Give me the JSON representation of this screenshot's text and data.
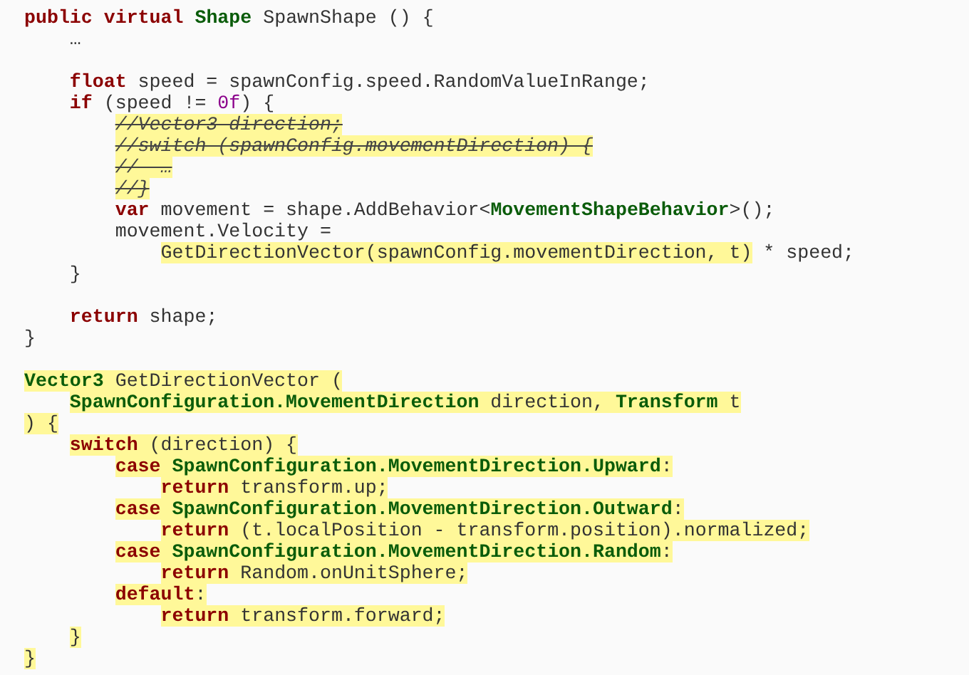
{
  "code_lines": [
    {
      "kind": "code",
      "spans": [
        {
          "text": "public",
          "kind": "keyword",
          "highlighted": false
        },
        {
          "text": " virtual",
          "kind": "keyword",
          "highlighted": false
        },
        {
          "text": " Shape",
          "kind": "type",
          "highlighted": false
        },
        {
          "text": " SpawnShape () {",
          "kind": "plain",
          "highlighted": false
        }
      ]
    },
    {
      "kind": "code",
      "spans": [
        {
          "text": "    …",
          "kind": "plain",
          "highlighted": false
        }
      ]
    },
    {
      "kind": "blank"
    },
    {
      "kind": "code",
      "spans": [
        {
          "text": "    float",
          "kind": "keyword",
          "highlighted": false
        },
        {
          "text": " speed = spawnConfig.speed.RandomValueInRange;",
          "kind": "plain",
          "highlighted": false
        }
      ]
    },
    {
      "kind": "code",
      "spans": [
        {
          "text": "    if",
          "kind": "keyword",
          "highlighted": false
        },
        {
          "text": " (speed != ",
          "kind": "plain",
          "highlighted": false
        },
        {
          "text": "0f",
          "kind": "number",
          "highlighted": false
        },
        {
          "text": ") {",
          "kind": "plain",
          "highlighted": false
        }
      ]
    },
    {
      "kind": "code",
      "spans": [
        {
          "text": "        //Vector3 direction;",
          "kind": "comment",
          "highlighted": true
        }
      ]
    },
    {
      "kind": "code",
      "spans": [
        {
          "text": "        //switch (spawnConfig.movementDirection) {",
          "kind": "comment",
          "highlighted": true
        }
      ]
    },
    {
      "kind": "code",
      "spans": [
        {
          "text": "        //  …",
          "kind": "comment",
          "highlighted": true
        }
      ]
    },
    {
      "kind": "code",
      "spans": [
        {
          "text": "        //}",
          "kind": "comment",
          "highlighted": true
        }
      ]
    },
    {
      "kind": "code",
      "spans": [
        {
          "text": "        var",
          "kind": "keyword",
          "highlighted": false
        },
        {
          "text": " movement = shape.AddBehavior<",
          "kind": "plain",
          "highlighted": false
        },
        {
          "text": "MovementShapeBehavior",
          "kind": "type",
          "highlighted": false
        },
        {
          "text": ">();",
          "kind": "plain",
          "highlighted": false
        }
      ]
    },
    {
      "kind": "code",
      "spans": [
        {
          "text": "        movement.Velocity =",
          "kind": "plain",
          "highlighted": false
        }
      ]
    },
    {
      "kind": "code",
      "spans": [
        {
          "text": "            GetDirectionVector(spawnConfig.movementDirection, t)",
          "kind": "plain",
          "highlighted": true
        },
        {
          "text": " * speed;",
          "kind": "plain",
          "highlighted": false
        }
      ]
    },
    {
      "kind": "code",
      "spans": [
        {
          "text": "    }",
          "kind": "plain",
          "highlighted": false
        }
      ]
    },
    {
      "kind": "blank"
    },
    {
      "kind": "code",
      "spans": [
        {
          "text": "    return",
          "kind": "keyword",
          "highlighted": false
        },
        {
          "text": " shape;",
          "kind": "plain",
          "highlighted": false
        }
      ]
    },
    {
      "kind": "code",
      "spans": [
        {
          "text": "}",
          "kind": "plain",
          "highlighted": false
        }
      ]
    },
    {
      "kind": "blank"
    },
    {
      "kind": "code",
      "spans": [
        {
          "text": "Vector3",
          "kind": "type",
          "highlighted": true
        },
        {
          "text": " GetDirectionVector (",
          "kind": "plain",
          "highlighted": true
        }
      ]
    },
    {
      "kind": "code",
      "spans": [
        {
          "text": "    SpawnConfiguration.MovementDirection",
          "kind": "type",
          "highlighted": true
        },
        {
          "text": " direction, ",
          "kind": "plain",
          "highlighted": true
        },
        {
          "text": "Transform",
          "kind": "type",
          "highlighted": true
        },
        {
          "text": " t",
          "kind": "plain",
          "highlighted": true
        }
      ]
    },
    {
      "kind": "code",
      "spans": [
        {
          "text": ") {",
          "kind": "plain",
          "highlighted": true
        }
      ]
    },
    {
      "kind": "code",
      "spans": [
        {
          "text": "    switch",
          "kind": "keyword",
          "highlighted": true
        },
        {
          "text": " (direction) {",
          "kind": "plain",
          "highlighted": true
        }
      ]
    },
    {
      "kind": "code",
      "spans": [
        {
          "text": "        case",
          "kind": "keyword",
          "highlighted": true
        },
        {
          "text": " SpawnConfiguration.MovementDirection.Upward",
          "kind": "type",
          "highlighted": true
        },
        {
          "text": ":",
          "kind": "plain",
          "highlighted": true
        }
      ]
    },
    {
      "kind": "code",
      "spans": [
        {
          "text": "            return",
          "kind": "keyword",
          "highlighted": true
        },
        {
          "text": " transform.up;",
          "kind": "plain",
          "highlighted": true
        }
      ]
    },
    {
      "kind": "code",
      "spans": [
        {
          "text": "        case",
          "kind": "keyword",
          "highlighted": true
        },
        {
          "text": " SpawnConfiguration.MovementDirection.Outward",
          "kind": "type",
          "highlighted": true
        },
        {
          "text": ":",
          "kind": "plain",
          "highlighted": true
        }
      ]
    },
    {
      "kind": "code",
      "spans": [
        {
          "text": "            return",
          "kind": "keyword",
          "highlighted": true
        },
        {
          "text": " (t.localPosition - transform.position).normalized;",
          "kind": "plain",
          "highlighted": true
        }
      ]
    },
    {
      "kind": "code",
      "spans": [
        {
          "text": "        case",
          "kind": "keyword",
          "highlighted": true
        },
        {
          "text": " SpawnConfiguration.MovementDirection.Random",
          "kind": "type",
          "highlighted": true
        },
        {
          "text": ":",
          "kind": "plain",
          "highlighted": true
        }
      ]
    },
    {
      "kind": "code",
      "spans": [
        {
          "text": "            return",
          "kind": "keyword",
          "highlighted": true
        },
        {
          "text": " Random.onUnitSphere;",
          "kind": "plain",
          "highlighted": true
        }
      ]
    },
    {
      "kind": "code",
      "spans": [
        {
          "text": "        default",
          "kind": "keyword",
          "highlighted": true
        },
        {
          "text": ":",
          "kind": "plain",
          "highlighted": true
        }
      ]
    },
    {
      "kind": "code",
      "spans": [
        {
          "text": "            return",
          "kind": "keyword",
          "highlighted": true
        },
        {
          "text": " transform.forward;",
          "kind": "plain",
          "highlighted": true
        }
      ]
    },
    {
      "kind": "code",
      "spans": [
        {
          "text": "    }",
          "kind": "plain",
          "highlighted": true
        }
      ]
    },
    {
      "kind": "code",
      "spans": [
        {
          "text": "}",
          "kind": "plain",
          "highlighted": true
        }
      ]
    }
  ]
}
